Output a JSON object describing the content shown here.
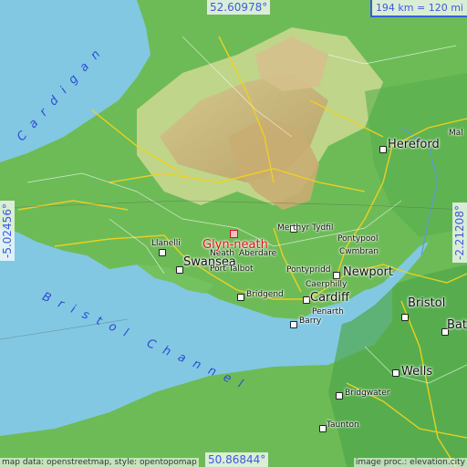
{
  "map": {
    "highlighted_place": "Glyn-neath",
    "places": [
      {
        "name": "Hereford"
      },
      {
        "name": "Llanelli"
      },
      {
        "name": "Swansea"
      },
      {
        "name": "Neath"
      },
      {
        "name": "Aberdare"
      },
      {
        "name": "Merthyr Tydfil"
      },
      {
        "name": "Pontypool"
      },
      {
        "name": "Cwmbran"
      },
      {
        "name": "Port Talbot"
      },
      {
        "name": "Pontypridd"
      },
      {
        "name": "Newport"
      },
      {
        "name": "Caerphilly"
      },
      {
        "name": "Bridgend"
      },
      {
        "name": "Cardiff"
      },
      {
        "name": "Penarth"
      },
      {
        "name": "Barry"
      },
      {
        "name": "Bristol"
      },
      {
        "name": "Bath"
      },
      {
        "name": "Wells"
      },
      {
        "name": "Bridgwater"
      },
      {
        "name": "Taunton"
      },
      {
        "name": "Mal"
      }
    ],
    "sea_labels": [
      "Cardigan",
      "Bristol Channel"
    ],
    "coordinates": {
      "north": "52.60978°",
      "south": "50.86844°",
      "west": "-5.02456°",
      "east": "-2.21208°"
    },
    "scale_text": "194 km = 120 mi",
    "attribution_left": "map data: openstreetmap, style: opentopomap",
    "attribution_right": "image proc.: elevation.city"
  }
}
